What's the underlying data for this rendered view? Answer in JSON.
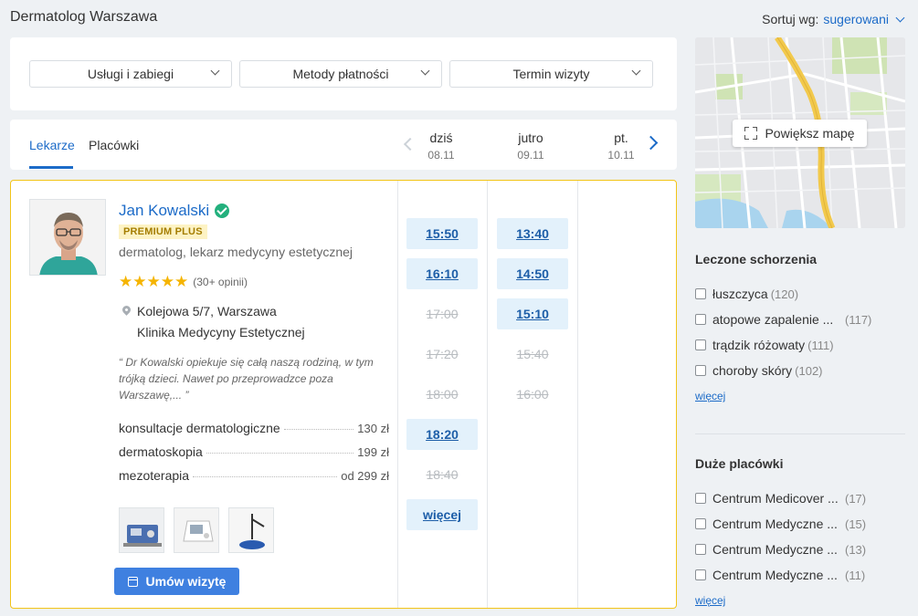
{
  "header": {
    "title": "Dermatolog Warszawa",
    "sort_label": "Sortuj wg:",
    "sort_value": "sugerowani"
  },
  "filters": [
    "Usługi i zabiegi",
    "Metody płatności",
    "Termin wizyty"
  ],
  "tabs": {
    "doctors": "Lekarze",
    "places": "Placówki"
  },
  "days": [
    {
      "name": "dziś",
      "date": "08.11"
    },
    {
      "name": "jutro",
      "date": "09.11"
    },
    {
      "name": "pt.",
      "date": "10.11"
    }
  ],
  "doctor": {
    "name": "Jan Kowalski",
    "badge": "PREMIUM PLUS",
    "specialty": "dermatolog, lekarz medycyny estetycznej",
    "rating": 5,
    "reviews": "(30+ opinii)",
    "address": "Kolejowa 5/7, Warszawa",
    "clinic": "Klinika Medycyny Estetycznej",
    "quote": "“ Dr Kowalski opiekuje się całą naszą rodziną, w tym trójką dzieci. Nawet po przeprowadzce poza Warszawę,... ”",
    "services": [
      {
        "name": "konsultacje dermatologiczne",
        "price": "130 zł"
      },
      {
        "name": "dermatoskopia",
        "price": "199 zł"
      },
      {
        "name": "mezoterapia",
        "price": "od 299 zł"
      }
    ],
    "book_label": "Umów wizytę"
  },
  "slots": {
    "day1": [
      {
        "time": "15:50",
        "available": true
      },
      {
        "time": "16:10",
        "available": true
      },
      {
        "time": "17:00",
        "available": false
      },
      {
        "time": "17:20",
        "available": false
      },
      {
        "time": "18:00",
        "available": false
      },
      {
        "time": "18:20",
        "available": true
      },
      {
        "time": "18:40",
        "available": false
      }
    ],
    "day2": [
      {
        "time": "13:40",
        "available": true
      },
      {
        "time": "14:50",
        "available": true
      },
      {
        "time": "15:10",
        "available": true
      },
      {
        "time": "15:40",
        "available": false
      },
      {
        "time": "16:00",
        "available": false
      }
    ],
    "more_label": "więcej"
  },
  "map": {
    "button_label": "Powiększ mapę"
  },
  "sidebar": {
    "conditions_title": "Leczone schorzenia",
    "conditions": [
      {
        "label": "łuszczyca",
        "count": "(120)"
      },
      {
        "label": "atopowe zapalenie ...",
        "count": "(117)"
      },
      {
        "label": "trądzik różowaty",
        "count": "(111)"
      },
      {
        "label": "choroby skóry",
        "count": "(102)"
      }
    ],
    "conditions_more": "więcej",
    "places_title": "Duże placówki",
    "places": [
      {
        "label": "Centrum Medicover ...",
        "count": "(17)"
      },
      {
        "label": "Centrum Medyczne ...",
        "count": "(15)"
      },
      {
        "label": "Centrum Medyczne ...",
        "count": "(13)"
      },
      {
        "label": "Centrum Medyczne ...",
        "count": "(11)"
      }
    ],
    "places_more": "więcej"
  },
  "colors": {
    "accent": "#1c6bc8",
    "premium_border": "#f2c418",
    "slot_bg": "#e3f1fb",
    "verified": "#23b07d",
    "star": "#f5b400"
  }
}
